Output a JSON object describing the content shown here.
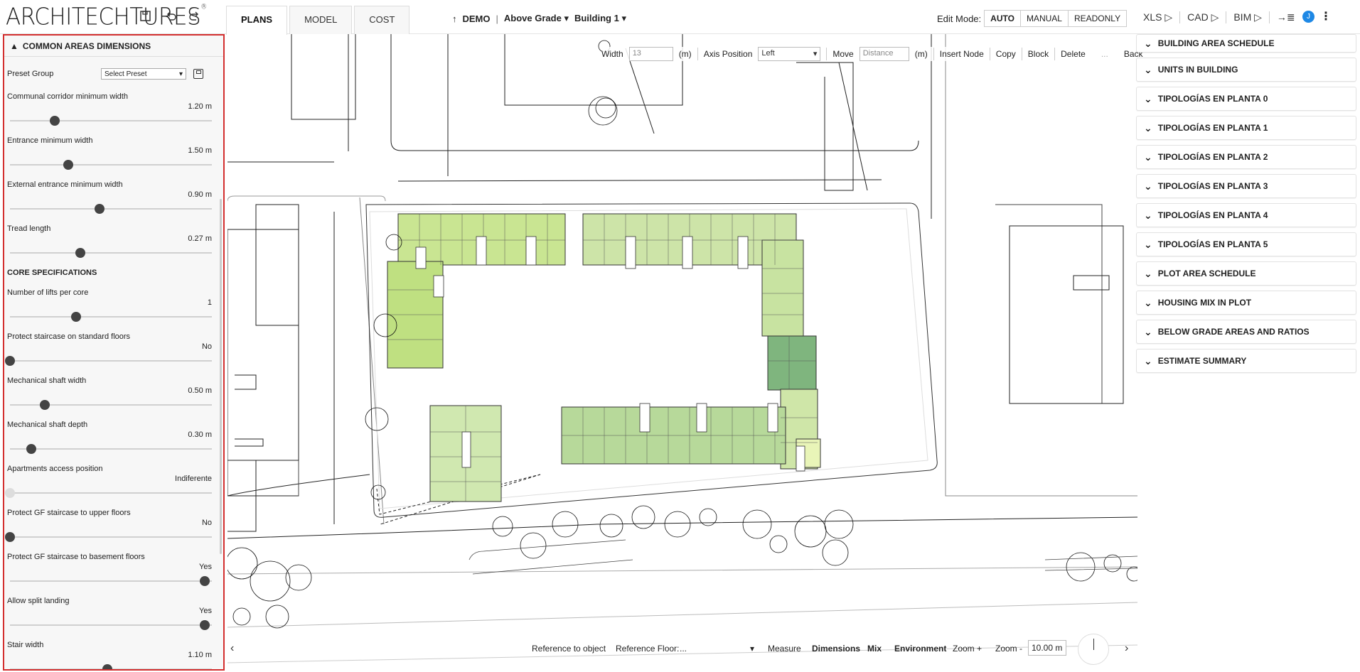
{
  "app": {
    "logo": "ARCHITECHTURES",
    "logo_mark": "®"
  },
  "tabs": [
    {
      "label": "PLANS",
      "active": true
    },
    {
      "label": "MODEL",
      "active": false
    },
    {
      "label": "COST",
      "active": false
    }
  ],
  "nav": {
    "arrow": "↑",
    "project": "DEMO",
    "separator": "|",
    "grade": "Above Grade",
    "building": "Building 1"
  },
  "edit_mode": {
    "label": "Edit Mode:",
    "options": [
      "AUTO",
      "MANUAL",
      "READONLY"
    ],
    "selected": "AUTO"
  },
  "exports": [
    "XLS ▷",
    "CAD ▷",
    "BIM ▷",
    "→≣"
  ],
  "user": {
    "initial": "J",
    "color": "#1e88e5"
  },
  "left_panel": {
    "title": "COMMON AREAS DIMENSIONS",
    "preset_label": "Preset Group",
    "preset_value": "Select Preset",
    "params_a": [
      {
        "name": "Communal corridor minimum width",
        "value": "1.20 m",
        "level": 0.23
      },
      {
        "name": "Entrance minimum width",
        "value": "1.50 m",
        "level": 0.3
      },
      {
        "name": "External entrance minimum width",
        "value": "0.90 m",
        "level": 0.46
      },
      {
        "name": "Tread length",
        "value": "0.27 m",
        "level": 0.36
      }
    ],
    "section_core": "CORE SPECIFICATIONS",
    "params_b": [
      {
        "name": "Number of lifts per core",
        "value": "1",
        "level": 0.34
      },
      {
        "name": "Protect staircase on standard floors",
        "value": "No",
        "level": 0.0
      },
      {
        "name": "Mechanical shaft width",
        "value": "0.50 m",
        "level": 0.18
      },
      {
        "name": "Mechanical shaft depth",
        "value": "0.30 m",
        "level": 0.11
      },
      {
        "name": "Apartments access position",
        "value": "Indiferente",
        "level": 0.0,
        "disabled": true
      },
      {
        "name": "Protect GF staircase to upper floors",
        "value": "No",
        "level": 0.0
      },
      {
        "name": "Protect GF staircase to basement floors",
        "value": "Yes",
        "level": 1.0
      },
      {
        "name": "Allow split landing",
        "value": "Yes",
        "level": 1.0
      },
      {
        "name": "Stair width",
        "value": "1.10 m",
        "level": 0.5
      }
    ]
  },
  "canvas_toolbar": {
    "width_label": "Width",
    "width_value": "13",
    "unit": "(m)",
    "axis_label": "Axis Position",
    "axis_value": "Left",
    "move_label": "Move",
    "move_placeholder": "Distance",
    "insert_node": "Insert Node",
    "copy": "Copy",
    "block": "Block",
    "delete": "Delete",
    "ellipsis": "...",
    "back": "Back"
  },
  "right_panel": [
    "BUILDING AREA SCHEDULE",
    "UNITS IN BUILDING",
    "TIPOLOGÍAS EN PLANTA 0",
    "TIPOLOGÍAS EN PLANTA 1",
    "TIPOLOGÍAS EN PLANTA 2",
    "TIPOLOGÍAS EN PLANTA 3",
    "TIPOLOGÍAS EN PLANTA 4",
    "TIPOLOGÍAS EN PLANTA 5",
    "PLOT AREA SCHEDULE",
    "HOUSING MIX IN PLOT",
    "BELOW GRADE AREAS AND RATIOS",
    "ESTIMATE SUMMARY"
  ],
  "bottom_toolbar": {
    "reference_object": "Reference to object",
    "reference_floor": "Reference Floor:",
    "reference_floor_value": "...",
    "measure": "Measure",
    "dimensions": "Dimensions",
    "mix": "Mix",
    "environment": "Environment",
    "zoom_in": "Zoom +",
    "zoom_out": "Zoom -",
    "zoom_value": "10.00 m"
  },
  "colors": {
    "accent_border": "#d32f2f",
    "unit_green_light": "#d4e9a8",
    "unit_green_dark": "#7fb57e"
  }
}
